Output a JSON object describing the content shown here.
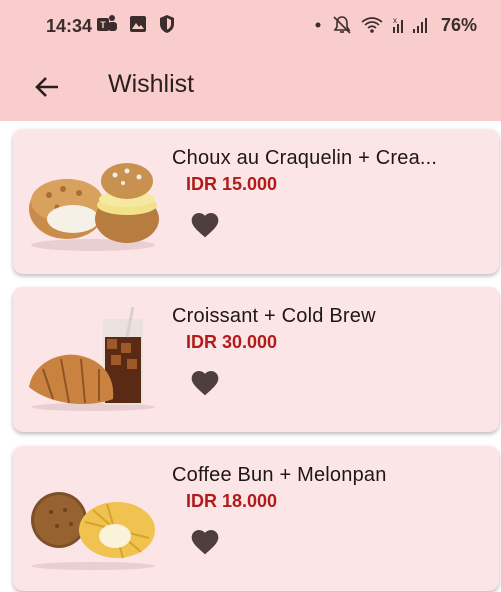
{
  "status_bar": {
    "time": "14:34",
    "battery": "76%",
    "icons_left": [
      "teams-icon",
      "gallery-icon",
      "shield-icon"
    ],
    "icons_right": [
      "dot-icon",
      "mute-bell-icon",
      "wifi-icon",
      "signal-icon"
    ]
  },
  "app_bar": {
    "title": "Wishlist",
    "back_icon": "arrow-left-icon"
  },
  "colors": {
    "app_bar_bg": "#f9cdcb",
    "card_bg": "#fbe5e7",
    "price": "#b31b1b",
    "heart": "#4e3e3e"
  },
  "items": [
    {
      "name": "Choux au Craquelin + Crea...",
      "price": "IDR 15.000",
      "image": "choux-image",
      "favorite": "heart-icon"
    },
    {
      "name": "Croissant + Cold Brew",
      "price": "IDR 30.000",
      "image": "croissant-coldbrew-image",
      "favorite": "heart-icon"
    },
    {
      "name": "Coffee Bun + Melonpan",
      "price": "IDR 18.000",
      "image": "coffeebun-melonpan-image",
      "favorite": "heart-icon"
    }
  ]
}
